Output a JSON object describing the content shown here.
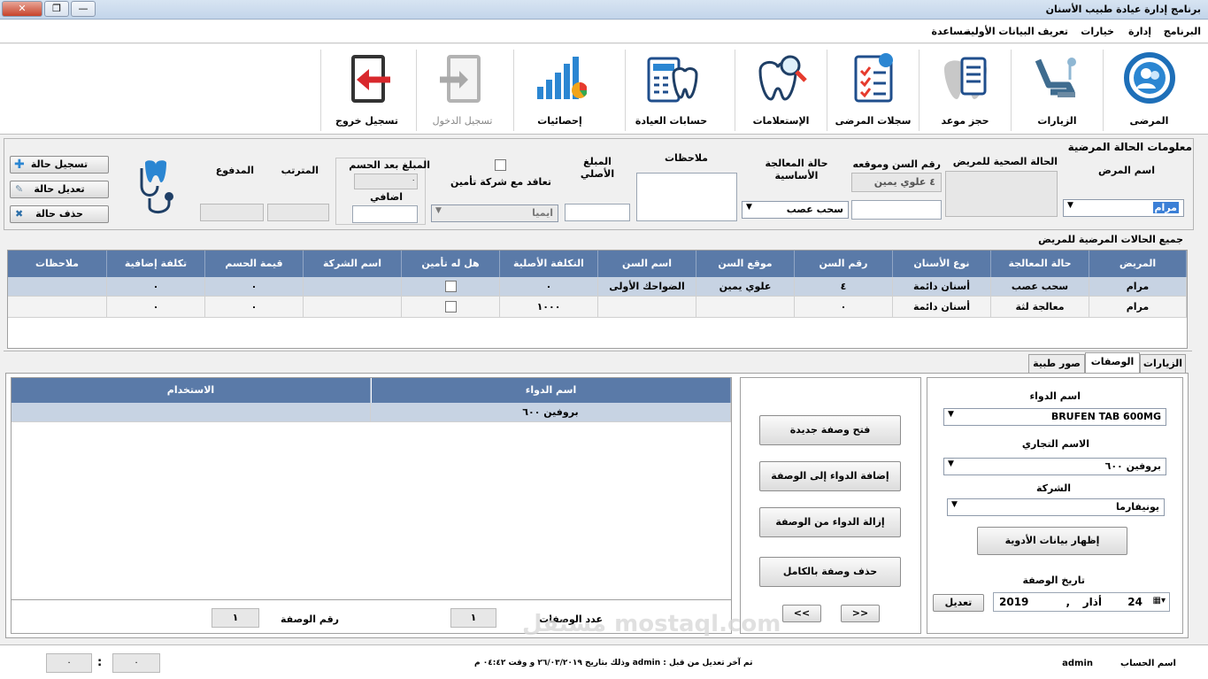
{
  "window": {
    "title": "برنامج إدارة عيادة طبيب الأسنان",
    "minimize": "—",
    "maximize": "❐",
    "close": "✕"
  },
  "menu": [
    "البرنامج",
    "إدارة",
    "خيارات",
    "تعريف البيانات الأولية",
    "مساعدة"
  ],
  "toolbar": [
    {
      "label": "المرضى",
      "icon": "patients-icon"
    },
    {
      "label": "الزيارات",
      "icon": "dental-chair-icon"
    },
    {
      "label": "حجز موعد",
      "icon": "appointment-icon"
    },
    {
      "label": "سجلات المرضى",
      "icon": "records-icon"
    },
    {
      "label": "الإستعلامات",
      "icon": "inquiry-icon"
    },
    {
      "label": "حسابات العيادة",
      "icon": "accounts-icon"
    },
    {
      "label": "إحصائيات",
      "icon": "statistics-icon"
    },
    {
      "label": "تسجيل الدخول",
      "icon": "login-icon",
      "disabled": true
    },
    {
      "label": "تسجيل خروج",
      "icon": "logout-icon"
    }
  ],
  "case_info": {
    "section_title": "معلومات الحالة المرضية",
    "patient_name_label": "اسم المرض",
    "patient_name_value": "مرام",
    "health_status_label": "الحالة الصحية للمريض",
    "tooth_label": "رقم السن وموقعه",
    "tooth_value": "٤ علوي يمين",
    "treatment_label": "حالة المعالجة الأساسية",
    "treatment_value": "سحب عصب",
    "notes_label": "ملاحظات",
    "original_amount_label": "المبلغ الأصلي",
    "original_amount_value": "",
    "insurance_label": "تعاقد مع شركة تأمين",
    "insurance_company": "ايميا",
    "after_discount_label": "المبلغ بعد الحسم",
    "after_discount_value": "٠",
    "extra_label": "اضافي",
    "extra_value": "",
    "remaining_label": "المترتب",
    "paid_label": "المدفوع",
    "add_button": "تسجيل حالة",
    "edit_button": "تعديل حالة",
    "delete_button": "حذف حالة"
  },
  "cases_table": {
    "title": "جميع الحالات المرضية للمريض",
    "columns": [
      "المريض",
      "حالة المعالجة",
      "نوع الأسنان",
      "رقم السن",
      "موقع السن",
      "اسم السن",
      "التكلفة الأصلية",
      "هل له تأمين",
      "اسم الشركة",
      "قيمة الحسم",
      "تكلفة إضافية",
      "ملاحظات"
    ],
    "rows": [
      [
        "مرام",
        "سحب عصب",
        "أسنان دائمة",
        "٤",
        "علوي يمين",
        "الضواحك الأولى",
        "٠",
        "",
        "",
        "٠",
        "٠",
        ""
      ],
      [
        "مرام",
        "معالجة لثة",
        "أسنان دائمة",
        "٠",
        "",
        "",
        "١٠٠٠",
        "",
        "",
        "٠",
        "٠",
        ""
      ]
    ]
  },
  "tabs": [
    "الزيارات",
    "الوصفات",
    "صور طبية"
  ],
  "prescription": {
    "drug_label": "اسم الدواء",
    "drug_value": "BRUFEN TAB 600MG",
    "trade_label": "الاسم التجاري",
    "trade_value": "بروفين ٦٠٠",
    "company_label": "الشركة",
    "company_value": "يونيفارما",
    "show_drug_data_button": "إظهار بيانات الأدوية",
    "date_label": "تاريخ الوصفة",
    "date_day": "24",
    "date_month": "أذار",
    "date_year": "2019",
    "date_sep": ",",
    "edit_date_button": "تعديل",
    "new_button": "فتح وصفة جديدة",
    "add_drug_button": "إضافة الدواء إلى الوصفة",
    "remove_drug_button": "إزالة الدواء من الوصفة",
    "delete_all_button": "حذف وصفة بالكامل",
    "nav_prev": "<<",
    "nav_next": ">>",
    "table_columns": [
      "اسم الدواء",
      "الاستخدام"
    ],
    "table_rows": [
      [
        "بروفين ٦٠٠",
        ""
      ]
    ],
    "count_label": "عدد الوصفات",
    "count_value": "١",
    "number_label": "رقم الوصفة",
    "number_value": "١"
  },
  "status": {
    "account_label": "اسم الحساب",
    "account_value": "admin",
    "last_edit": "تم آخر تعديل من قبل : admin وذلك بتاريخ ٢٦/٠٣/٢٠١٩ و وقت ٠٤:٤٢ م",
    "clock_a": "٠",
    "clock_sep": ":",
    "clock_b": "٠"
  },
  "watermark": "مستقل mostaql.com"
}
